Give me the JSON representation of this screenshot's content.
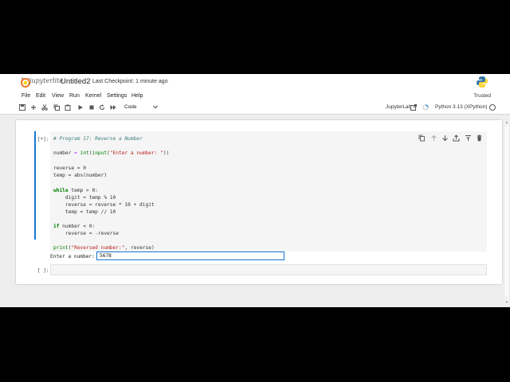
{
  "header": {
    "logo_text": "jupyterlite",
    "notebook_title": "Untitled2",
    "checkpoint_label": "Last Checkpoint:",
    "checkpoint_time": "1 minute ago"
  },
  "menu": {
    "items": [
      "File",
      "Edit",
      "View",
      "Run",
      "Kernel",
      "Settings",
      "Help"
    ],
    "trusted_label": "Trusted"
  },
  "toolbar": {
    "buttons": [
      "save-icon",
      "add-icon",
      "cut-icon",
      "copy-icon",
      "paste-icon",
      "run-icon",
      "stop-icon",
      "restart-icon",
      "fast-forward-icon"
    ],
    "cell_type": "Code",
    "jupyterlab_link": "JupyterLab",
    "kernel_name": "Python 3.13 (XPython)"
  },
  "cells": [
    {
      "prompt": "[*]:",
      "code": {
        "comment": "# Program 17: Reverse a Number",
        "l1_var": "number",
        "l1_eq": " = ",
        "l1_int": "int",
        "l1_open": "(",
        "l1_input": "input",
        "l1_str": "\"Enter a number: \"",
        "l1_close": "))",
        "l2": "reverse = 0",
        "l3": "temp = abs(number)",
        "l4_kw": "while",
        "l4_rest": " temp > 0:",
        "l5": "    digit = temp % 10",
        "l6": "    reverse = reverse * 10 + digit",
        "l7": "    temp = temp // 10",
        "l8_kw": "if",
        "l8_rest": " number < 0:",
        "l9": "    reverse = -reverse",
        "l10_print": "print",
        "l10_open": "(",
        "l10_str": "\"Reversed number:\"",
        "l10_rest": ", reverse)"
      },
      "stdin_prompt": "Enter a number:",
      "stdin_value": "5678"
    },
    {
      "prompt": "[ ]:"
    }
  ],
  "colors": {
    "accent": "#1976d2",
    "keyword": "#008000",
    "string": "#ba2121",
    "comment": "#3d7b7b"
  }
}
